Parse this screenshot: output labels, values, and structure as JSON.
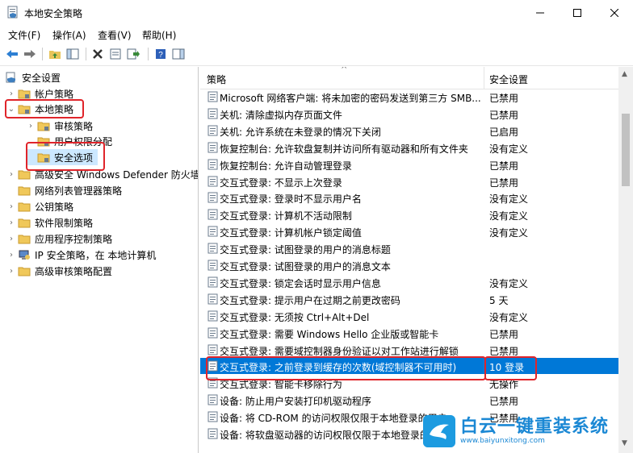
{
  "window": {
    "title": "本地安全策略"
  },
  "menu": [
    "文件(F)",
    "操作(A)",
    "查看(V)",
    "帮助(H)"
  ],
  "tree": [
    {
      "label": "安全设置",
      "indent": 0,
      "chev": ""
    },
    {
      "label": "帐户策略",
      "indent": 1,
      "chev": "›"
    },
    {
      "label": "本地策略",
      "indent": 1,
      "chev": "⌄"
    },
    {
      "label": "审核策略",
      "indent": 2,
      "chev": "›"
    },
    {
      "label": "用户权限分配",
      "indent": 2,
      "chev": ""
    },
    {
      "label": "安全选项",
      "indent": 2,
      "chev": ""
    },
    {
      "label": "高级安全 Windows Defender 防火墙",
      "indent": 1,
      "chev": "›"
    },
    {
      "label": "网络列表管理器策略",
      "indent": 1,
      "chev": ""
    },
    {
      "label": "公钥策略",
      "indent": 1,
      "chev": "›"
    },
    {
      "label": "软件限制策略",
      "indent": 1,
      "chev": "›"
    },
    {
      "label": "应用程序控制策略",
      "indent": 1,
      "chev": "›"
    },
    {
      "label": "IP 安全策略，在 本地计算机",
      "indent": 1,
      "chev": "›"
    },
    {
      "label": "高级审核策略配置",
      "indent": 1,
      "chev": "›"
    }
  ],
  "columns": {
    "policy": "策略",
    "setting": "安全设置"
  },
  "rows": [
    {
      "policy": "Microsoft 网络客户端: 将未加密的密码发送到第三方 SMB...",
      "setting": "已禁用"
    },
    {
      "policy": "关机: 清除虚拟内存页面文件",
      "setting": "已禁用"
    },
    {
      "policy": "关机: 允许系统在未登录的情况下关闭",
      "setting": "已启用"
    },
    {
      "policy": "恢复控制台: 允许软盘复制并访问所有驱动器和所有文件夹",
      "setting": "没有定义"
    },
    {
      "policy": "恢复控制台: 允许自动管理登录",
      "setting": "已禁用"
    },
    {
      "policy": "交互式登录: 不显示上次登录",
      "setting": "已禁用"
    },
    {
      "policy": "交互式登录: 登录时不显示用户名",
      "setting": "没有定义"
    },
    {
      "policy": "交互式登录: 计算机不活动限制",
      "setting": "没有定义"
    },
    {
      "policy": "交互式登录: 计算机帐户锁定阈值",
      "setting": "没有定义"
    },
    {
      "policy": "交互式登录: 试图登录的用户的消息标题",
      "setting": ""
    },
    {
      "policy": "交互式登录: 试图登录的用户的消息文本",
      "setting": ""
    },
    {
      "policy": "交互式登录: 锁定会话时显示用户信息",
      "setting": "没有定义"
    },
    {
      "policy": "交互式登录: 提示用户在过期之前更改密码",
      "setting": "5 天"
    },
    {
      "policy": "交互式登录: 无须按 Ctrl+Alt+Del",
      "setting": "没有定义"
    },
    {
      "policy": "交互式登录: 需要 Windows Hello 企业版或智能卡",
      "setting": "已禁用"
    },
    {
      "policy": "交互式登录: 需要域控制器身份验证以对工作站进行解锁",
      "setting": "已禁用"
    },
    {
      "policy": "交互式登录: 之前登录到缓存的次数(域控制器不可用时)",
      "setting": "10 登录"
    },
    {
      "policy": "交互式登录: 智能卡移除行为",
      "setting": "无操作"
    },
    {
      "policy": "设备: 防止用户安装打印机驱动程序",
      "setting": "已禁用"
    },
    {
      "policy": "设备: 将 CD-ROM 的访问权限仅限于本地登录的用户",
      "setting": "已禁用"
    },
    {
      "policy": "设备: 将软盘驱动器的访问权限仅限于本地登录的用户",
      "setting": ""
    }
  ],
  "selected_row": 16,
  "watermark": {
    "title": "白云一键重装系统",
    "url": "www.baiyunxitong.com"
  },
  "colors": {
    "selection": "#0078d7",
    "highlight_box": "#e0242a",
    "watermark": "#1b88d4"
  }
}
